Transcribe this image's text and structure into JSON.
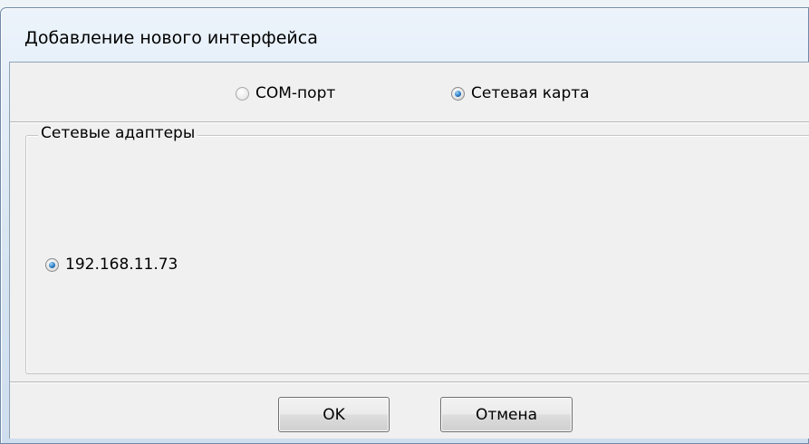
{
  "dialog": {
    "title": "Добавление нового интерфейса"
  },
  "interface_type": {
    "options": [
      {
        "label": "COM-порт",
        "selected": false
      },
      {
        "label": "Сетевая карта",
        "selected": true
      }
    ]
  },
  "network_adapters": {
    "group_label": "Сетевые адаптеры",
    "adapters": [
      {
        "label": "192.168.11.73",
        "selected": true
      }
    ]
  },
  "buttons": {
    "ok_label": "OK",
    "cancel_label": "Отмена"
  },
  "colors": {
    "radio_selected": "#2c7ec6",
    "client_background": "#f0f0f0",
    "window_frame": "#d6e4f1"
  },
  "icons": {
    "radio_on": "radio-selected-icon",
    "radio_off": "radio-unselected-icon"
  }
}
